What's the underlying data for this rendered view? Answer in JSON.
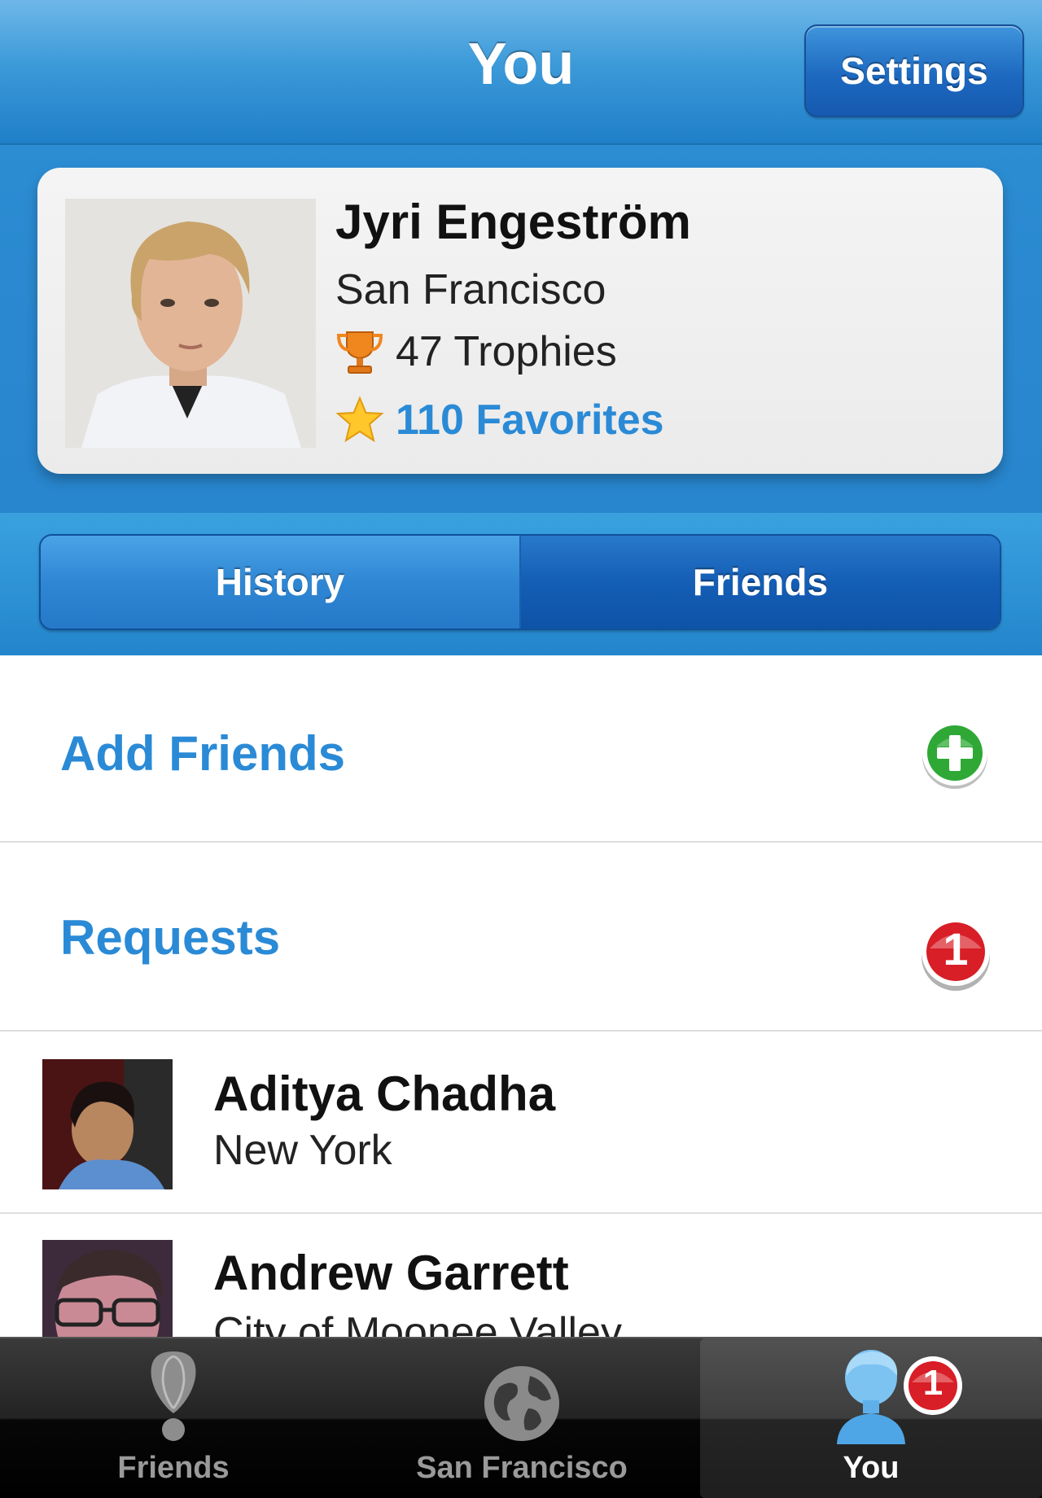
{
  "nav": {
    "title": "You",
    "settings_label": "Settings"
  },
  "profile": {
    "name": "Jyri Engeström",
    "city": "San Francisco",
    "trophies": "47 Trophies",
    "favorites": "110 Favorites"
  },
  "segments": {
    "history_label": "History",
    "friends_label": "Friends",
    "selected": "Friends"
  },
  "actions": {
    "add_friends": "Add Friends",
    "requests": "Requests",
    "requests_count": "1"
  },
  "friends": [
    {
      "name": "Aditya Chadha",
      "city": "New York"
    },
    {
      "name": "Andrew Garrett",
      "city": "City of Moonee Valley"
    }
  ],
  "tabbar": {
    "items": [
      {
        "label": "Friends",
        "icon": "pin-icon"
      },
      {
        "label": "San Francisco",
        "icon": "globe-icon"
      },
      {
        "label": "You",
        "icon": "person-icon"
      }
    ],
    "you_badge": "1",
    "active": "You"
  },
  "colors": {
    "accent_blue": "#2a8ad6",
    "header_blue": "#2684cc",
    "badge_red": "#d81e26",
    "add_green": "#2fa836"
  }
}
